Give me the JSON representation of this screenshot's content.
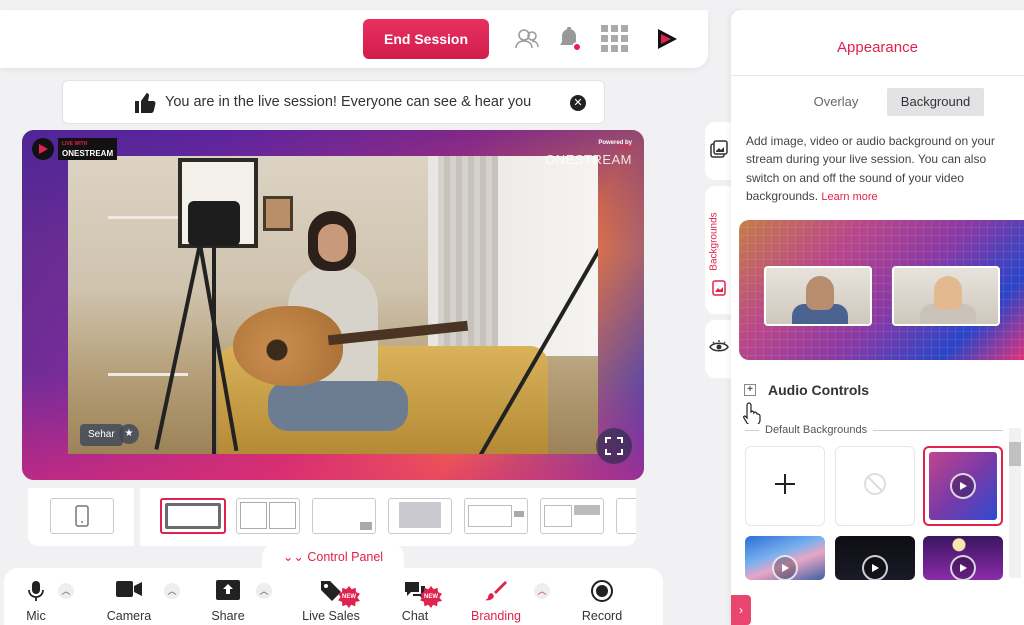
{
  "header": {
    "end_session_label": "End Session",
    "icons": [
      "guests-icon",
      "bell-icon",
      "apps-grid-icon",
      "onestream-logo-icon"
    ]
  },
  "notice": {
    "text": "You are in the live session! Everyone can see & hear you"
  },
  "stage": {
    "brand_small": "LIVE WITH",
    "brand_name": "ONESTREAM",
    "powered_by": "Powered by",
    "powered_live": "LIVE",
    "powered_brand": "ONESTREAM",
    "participant_name": "Sehar"
  },
  "control_panel": {
    "tab_label": "Control Panel",
    "items": [
      {
        "label": "Mic"
      },
      {
        "label": "Camera"
      },
      {
        "label": "Share"
      },
      {
        "label": "Live Sales",
        "badge": "NEW"
      },
      {
        "label": "Chat",
        "badge": "NEW"
      },
      {
        "label": "Branding"
      },
      {
        "label": "Record"
      }
    ]
  },
  "appearance": {
    "title": "Appearance",
    "tabs": {
      "overlay": "Overlay",
      "background": "Background"
    },
    "active_tab": "background",
    "side_tab_label": "Backgrounds",
    "description": "Add image, video or audio background on your stream during your live session. You can also switch on and off the sound of your video backgrounds.",
    "learn_more": "Learn more",
    "audio_controls": "Audio Controls",
    "default_backgrounds": "Default Backgrounds"
  },
  "colors": {
    "accent": "#e0224f",
    "panel_bg": "#ffffff",
    "app_bg": "#f1f1f3"
  }
}
